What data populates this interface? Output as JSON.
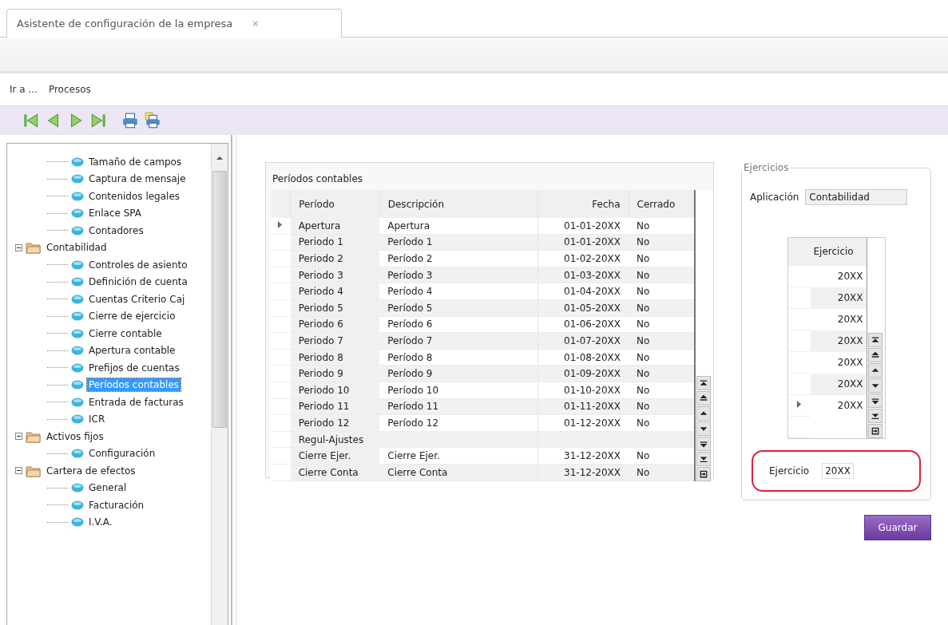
{
  "tab": {
    "title": "Asistente de configuración de la empresa",
    "close": "×"
  },
  "menu": [
    {
      "label": "Ir a ..."
    },
    {
      "label": "Procesos"
    }
  ],
  "toolbar": [
    {
      "kind": "first"
    },
    {
      "kind": "prev"
    },
    {
      "kind": "next"
    },
    {
      "kind": "last"
    },
    {
      "kind": "print"
    },
    {
      "kind": "print-preview"
    }
  ],
  "tree": [
    {
      "children": [
        {
          "label": "Tamaño de campos",
          "selected": false
        },
        {
          "label": "Captura de mensaje",
          "selected": false
        },
        {
          "label": "Contenidos legales",
          "selected": false
        },
        {
          "label": "Enlace SPA",
          "selected": false
        },
        {
          "label": "Contadores",
          "selected": false
        }
      ]
    },
    {
      "label": "Contabilidad",
      "expanded": true,
      "selected": false,
      "children": [
        {
          "label": "Controles de asiento",
          "selected": false
        },
        {
          "label": "Definición de cuenta",
          "selected": false
        },
        {
          "label": "Cuentas Criterio Caj",
          "selected": false
        },
        {
          "label": "Cierre de ejercicio",
          "selected": false
        },
        {
          "label": "Cierre contable",
          "selected": false
        },
        {
          "label": "Apertura contable",
          "selected": false
        },
        {
          "label": "Prefijos de cuentas",
          "selected": false
        },
        {
          "label": "Períodos contables",
          "selected": true
        },
        {
          "label": "Entrada de facturas",
          "selected": false
        },
        {
          "label": "ICR",
          "selected": false
        }
      ]
    },
    {
      "label": "Activos fijos",
      "expanded": true,
      "selected": false,
      "children": [
        {
          "label": "Configuración",
          "selected": false
        }
      ]
    },
    {
      "label": "Cartera de efectos",
      "expanded": true,
      "selected": false,
      "children": [
        {
          "label": "General",
          "selected": false
        },
        {
          "label": "Facturación",
          "selected": false
        },
        {
          "label": "I.V.A.",
          "selected": false
        }
      ]
    }
  ],
  "periods": {
    "title": "Períodos contables",
    "columns": [
      "Período",
      "Descripción",
      "Fecha",
      "Cerrado"
    ],
    "rows": [
      {
        "cells": [
          "Apertura",
          "Apertura",
          "01-01-20XX",
          "No"
        ],
        "selected": true
      },
      {
        "cells": [
          "Periodo 1",
          "Período 1",
          "01-01-20XX",
          "No"
        ],
        "selected": false
      },
      {
        "cells": [
          "Periodo 2",
          "Período 2",
          "01-02-20XX",
          "No"
        ],
        "selected": false
      },
      {
        "cells": [
          "Periodo 3",
          "Período 3",
          "01-03-20XX",
          "No"
        ],
        "selected": false
      },
      {
        "cells": [
          "Periodo 4",
          "Período 4",
          "01-04-20XX",
          "No"
        ],
        "selected": false
      },
      {
        "cells": [
          "Periodo 5",
          "Período 5",
          "01-05-20XX",
          "No"
        ],
        "selected": false
      },
      {
        "cells": [
          "Periodo 6",
          "Período 6",
          "01-06-20XX",
          "No"
        ],
        "selected": false
      },
      {
        "cells": [
          "Periodo 7",
          "Período 7",
          "01-07-20XX",
          "No"
        ],
        "selected": false
      },
      {
        "cells": [
          "Periodo 8",
          "Período 8",
          "01-08-20XX",
          "No"
        ],
        "selected": false
      },
      {
        "cells": [
          "Periodo 9",
          "Período 9",
          "01-09-20XX",
          "No"
        ],
        "selected": false
      },
      {
        "cells": [
          "Periodo 10",
          "Período 10",
          "01-10-20XX",
          "No"
        ],
        "selected": false
      },
      {
        "cells": [
          "Periodo 11",
          "Período 11",
          "01-11-20XX",
          "No"
        ],
        "selected": false
      },
      {
        "cells": [
          "Periodo 12",
          "Período 12",
          "01-12-20XX",
          "No"
        ],
        "selected": false
      },
      {
        "cells": [
          "Regul-Ajustes"
        ],
        "selected": false
      },
      {
        "cells": [
          "Cierre Ejer.",
          "Cierre Ejer.",
          "31-12-20XX",
          "No"
        ],
        "selected": false
      },
      {
        "cells": [
          "Cierre Conta",
          "Cierre Conta",
          "31-12-20XX",
          "No"
        ],
        "selected": false
      }
    ]
  },
  "exercises": {
    "title": "Ejercicios",
    "app_label": "Aplicación",
    "app_value": "Contabilidad",
    "column": "Ejercicio",
    "rows": [
      {
        "value": "20XX",
        "selected": false
      },
      {
        "value": "20XX",
        "selected": false
      },
      {
        "value": "20XX",
        "selected": false
      },
      {
        "value": "20XX",
        "selected": false
      },
      {
        "value": "20XX",
        "selected": false
      },
      {
        "value": "20XX",
        "selected": false
      },
      {
        "value": "20XX",
        "selected": true
      }
    ],
    "field_label": "Ejercicio",
    "field_value": "20XX"
  },
  "save_button": {
    "label": "Guardar"
  }
}
